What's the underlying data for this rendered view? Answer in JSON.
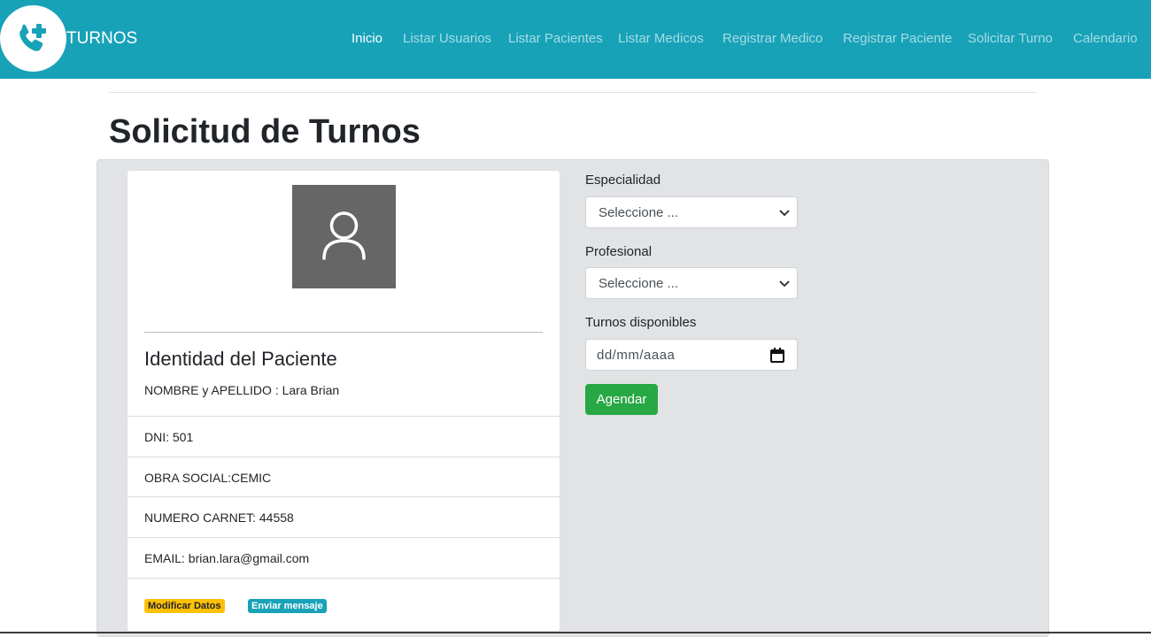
{
  "brand": {
    "name": "TURNOS",
    "icon": "phone-plus-icon"
  },
  "nav": [
    {
      "label": "Inicio",
      "active": true
    },
    {
      "label": "Listar Usuarios"
    },
    {
      "label": "Listar Pacientes"
    },
    {
      "label": "Listar Medicos"
    },
    {
      "label": "Registrar Medico"
    },
    {
      "label": "Registrar Paciente"
    },
    {
      "label": "Solicitar Turno"
    },
    {
      "label": "Calendario"
    }
  ],
  "page": {
    "title": "Solicitud de Turnos"
  },
  "patient_card": {
    "avatar_icon": "user-icon",
    "heading": "Identidad del Paciente",
    "name_line": "NOMBRE y APELLIDO : Lara Brian",
    "items": [
      "DNI: 501",
      "OBRA SOCIAL:CEMIC",
      "NUMERO CARNET: 44558",
      "EMAIL: brian.lara@gmail.com"
    ],
    "actions": {
      "modify": "Modificar Datos",
      "message": "Enviar mensaje"
    }
  },
  "form": {
    "especialidad": {
      "label": "Especialidad",
      "value": "Seleccione ..."
    },
    "profesional": {
      "label": "Profesional",
      "value": "Seleccione ..."
    },
    "turnos": {
      "label": "Turnos disponibles",
      "value": "dd/mm/aaaa"
    },
    "submit": "Agendar"
  },
  "colors": {
    "navbar": "#17a2b8",
    "success": "#28a745",
    "warning": "#ffc107",
    "panel": "#e2e3e5"
  }
}
